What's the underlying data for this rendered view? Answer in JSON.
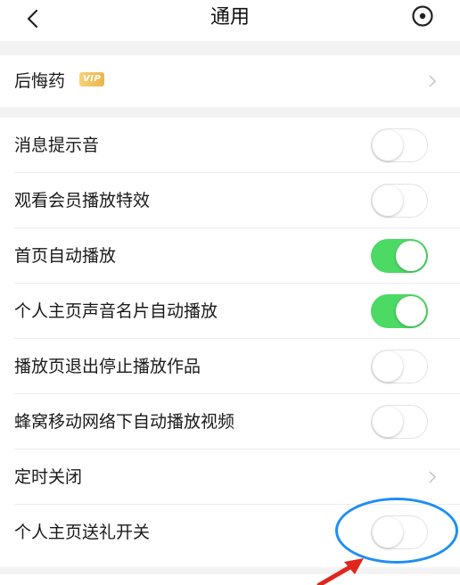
{
  "header": {
    "title": "通用",
    "back_icon": "chevron-left-icon",
    "right_icon": "target-icon"
  },
  "section1": {
    "items": [
      {
        "label": "后悔药",
        "badge": "VIP",
        "type": "link"
      }
    ]
  },
  "settings": {
    "items": [
      {
        "label": "消息提示音",
        "type": "toggle",
        "on": false
      },
      {
        "label": "观看会员播放特效",
        "type": "toggle",
        "on": false
      },
      {
        "label": "首页自动播放",
        "type": "toggle",
        "on": true
      },
      {
        "label": "个人主页声音名片自动播放",
        "type": "toggle",
        "on": true
      },
      {
        "label": "播放页退出停止播放作品",
        "type": "toggle",
        "on": false
      },
      {
        "label": "蜂窝移动网络下自动播放视频",
        "type": "toggle",
        "on": false
      },
      {
        "label": "定时关闭",
        "type": "link"
      },
      {
        "label": "个人主页送礼开关",
        "type": "toggle",
        "on": false
      }
    ]
  },
  "colors": {
    "toggle_on": "#4cd964",
    "annotation_circle": "#1f8ef5",
    "annotation_arrow": "#e0261c",
    "vip_badge": "#eab54a"
  }
}
